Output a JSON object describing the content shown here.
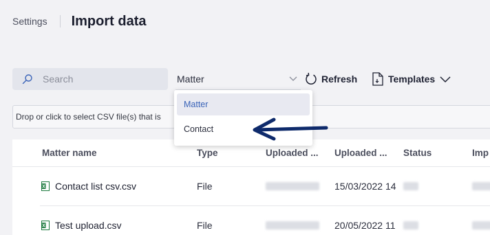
{
  "header": {
    "breadcrumb": "Settings",
    "title": "Import data"
  },
  "toolbar": {
    "search_placeholder": "Search",
    "select_value": "Matter",
    "refresh_label": "Refresh",
    "templates_label": "Templates"
  },
  "dropzone": {
    "text": "Drop or click to select CSV file(s) that is"
  },
  "dropdown": {
    "options": [
      "Matter",
      "Contact"
    ],
    "selected": "Matter"
  },
  "table": {
    "columns": [
      "Matter name",
      "Type",
      "Uploaded ...",
      "Uploaded ...",
      "Status",
      "Imp"
    ],
    "rows": [
      {
        "name": "Contact list csv.csv",
        "type": "File",
        "date": "15/03/2022 14"
      },
      {
        "name": "Test upload.csv",
        "type": "File",
        "date": "20/05/2022 11"
      }
    ]
  },
  "colors": {
    "accent_blue": "#3a63b8",
    "arrow_navy": "#0e2a6b",
    "excel_green": "#1d7a3e"
  },
  "icons": [
    "search-icon",
    "chevron-down-icon",
    "refresh-icon",
    "document-icon",
    "excel-file-icon",
    "arrow-icon"
  ]
}
